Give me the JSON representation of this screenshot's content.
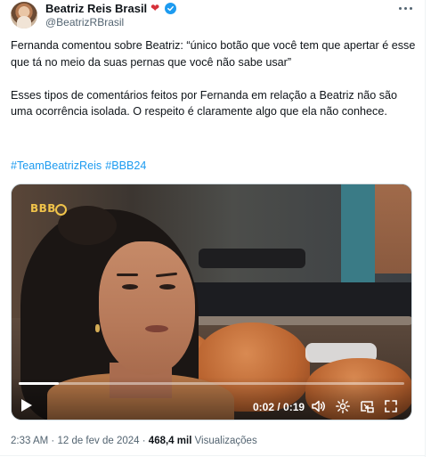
{
  "author": {
    "name": "Beatriz Reis Brasil",
    "handle": "@BeatrizRBrasil",
    "emoji_icon": "strawberry-heart-icon",
    "verified_icon": "verified-badge-icon"
  },
  "tweet": {
    "paragraph1": "Fernanda comentou sobre Beatriz: “único botão que você tem que apertar é esse que tá no meio da suas pernas que você não sabe usar”",
    "paragraph2": "Esses tipos de comentários feitos por Fernanda em relação a Beatriz não são uma ocorrência isolada. O respeito é claramente algo que ela não conhece.",
    "hashtags": [
      "#TeamBeatrizReis",
      "#BBB24"
    ]
  },
  "video": {
    "watermark": "BBB",
    "time_display": "0:02 / 0:19",
    "progress_fraction": 0.105,
    "controls_icons": [
      "play-icon",
      "volume-icon",
      "settings-icon",
      "pip-icon",
      "fullscreen-icon"
    ]
  },
  "meta": {
    "time": "2:33 AM",
    "separator": "·",
    "date": "12 de fev de 2024",
    "views_count": "468,4 mil",
    "views_label": "Visualizações"
  },
  "colors": {
    "link": "#1d9bf0",
    "text": "#0f1419",
    "muted": "#536471"
  }
}
